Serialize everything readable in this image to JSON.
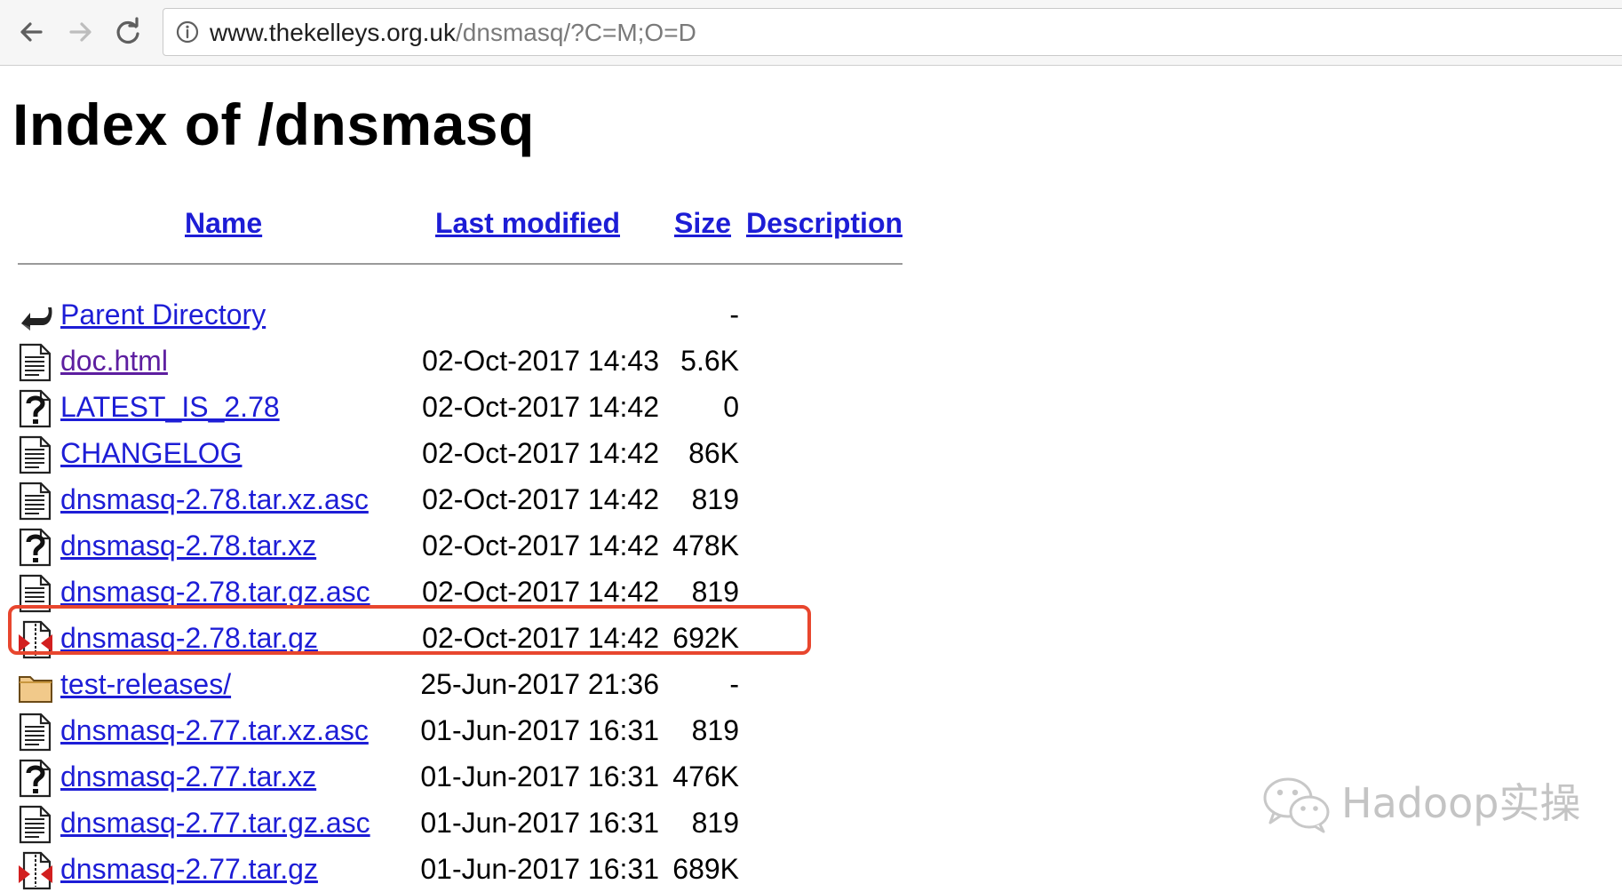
{
  "browser": {
    "url_host": "www.thekelleys.org.uk",
    "url_path": "/dnsmasq/?C=M;O=D"
  },
  "page": {
    "title": "Index of /dnsmasq",
    "columns": {
      "name": "Name",
      "last_modified": "Last modified",
      "size": "Size",
      "description": "Description"
    }
  },
  "rows": [
    {
      "icon": "back-icon",
      "name": "Parent Directory",
      "date": "",
      "size": "-",
      "visited": false
    },
    {
      "icon": "text-file-icon",
      "name": "doc.html",
      "date": "02-Oct-2017 14:43",
      "size": "5.6K",
      "visited": true
    },
    {
      "icon": "unknown-file-icon",
      "name": "LATEST_IS_2.78",
      "date": "02-Oct-2017 14:42",
      "size": "0",
      "visited": false
    },
    {
      "icon": "text-file-icon",
      "name": "CHANGELOG",
      "date": "02-Oct-2017 14:42",
      "size": "86K",
      "visited": false
    },
    {
      "icon": "text-file-icon",
      "name": "dnsmasq-2.78.tar.xz.asc",
      "date": "02-Oct-2017 14:42",
      "size": "819",
      "visited": false
    },
    {
      "icon": "unknown-file-icon",
      "name": "dnsmasq-2.78.tar.xz",
      "date": "02-Oct-2017 14:42",
      "size": "478K",
      "visited": false
    },
    {
      "icon": "text-file-icon",
      "name": "dnsmasq-2.78.tar.gz.asc",
      "date": "02-Oct-2017 14:42",
      "size": "819",
      "visited": false
    },
    {
      "icon": "compressed-file-icon",
      "name": "dnsmasq-2.78.tar.gz",
      "date": "02-Oct-2017 14:42",
      "size": "692K",
      "visited": false
    },
    {
      "icon": "folder-icon",
      "name": "test-releases/",
      "date": "25-Jun-2017 21:36",
      "size": "-",
      "visited": false
    },
    {
      "icon": "text-file-icon",
      "name": "dnsmasq-2.77.tar.xz.asc",
      "date": "01-Jun-2017 16:31",
      "size": "819",
      "visited": false
    },
    {
      "icon": "unknown-file-icon",
      "name": "dnsmasq-2.77.tar.xz",
      "date": "01-Jun-2017 16:31",
      "size": "476K",
      "visited": false
    },
    {
      "icon": "text-file-icon",
      "name": "dnsmasq-2.77.tar.gz.asc",
      "date": "01-Jun-2017 16:31",
      "size": "819",
      "visited": false
    },
    {
      "icon": "compressed-file-icon",
      "name": "dnsmasq-2.77.tar.gz",
      "date": "01-Jun-2017 16:31",
      "size": "689K",
      "visited": false
    }
  ],
  "highlighted_row": 7,
  "watermark": {
    "text": "Hadoop实操",
    "icon": "wechat-icon"
  },
  "colors": {
    "link": "#1d1dd6",
    "visited_link": "#5d1ea0",
    "highlight_border": "#e8462e"
  }
}
